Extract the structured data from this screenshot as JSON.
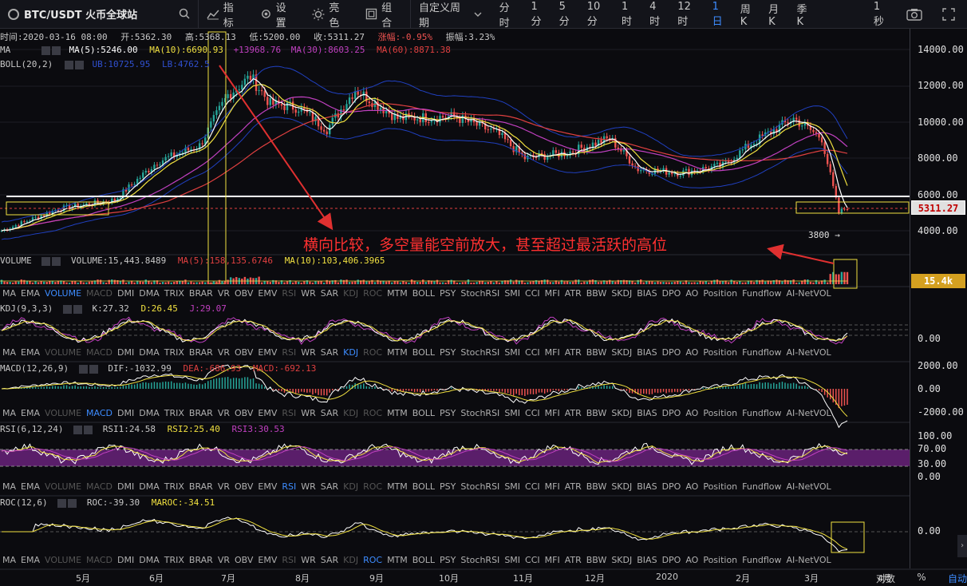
{
  "toolbar": {
    "symbol": "BTC/USDT 火币全球站",
    "indicator_label": "指标",
    "settings_label": "设置",
    "brightness_label": "亮色",
    "combo_label": "组合",
    "custom_period_label": "自定义周期",
    "periods": [
      "分时",
      "1分",
      "5分",
      "10分",
      "1时",
      "4时",
      "12时",
      "1日",
      "周K",
      "月K",
      "季K"
    ],
    "active_period": "1日",
    "refresh_label": "1秒"
  },
  "info_bar": {
    "time": "时间:2020-03-16 08:00",
    "open": "开:5362.30",
    "high": "高:5368.13",
    "low": "低:5200.00",
    "close": "收:5311.27",
    "change": "涨幅:-0.95%",
    "amplitude": "振幅:3.23%"
  },
  "ma_row": {
    "name": "MA",
    "ma5": "MA(5):5246.00",
    "ma10": "MA(10):6690.93",
    "ma30": "MA(30):8603.25",
    "ma60": "MA(60):8871.38",
    "overlay": "+13968.76"
  },
  "boll_row": {
    "name": "BOLL(20,2)",
    "ub": "UB:10725.95",
    "lb": "LB:4762.5"
  },
  "price_axis": [
    "14000.00",
    "12000.00",
    "10000.00",
    "8000.00",
    "6000.00",
    "4000.00"
  ],
  "last_price": "5311.27",
  "low_marker": "3800",
  "annotation": "横向比较，多空量能空前放大，甚至超过最活跃的高位",
  "volume_row": {
    "name": "VOLUME",
    "volume": "VOLUME:15,443.8489",
    "ma5": "MA(5):158,135.6746",
    "ma10": "MA(10):103,406.3965",
    "tag": "15.4k"
  },
  "tabs": [
    "MA",
    "EMA",
    "VOLUME",
    "MACD",
    "DMI",
    "DMA",
    "TRIX",
    "BRAR",
    "VR",
    "OBV",
    "EMV",
    "RSI",
    "WR",
    "SAR",
    "KDJ",
    "ROC",
    "MTM",
    "BOLL",
    "PSY",
    "StochRSI",
    "SMI",
    "CCI",
    "MFI",
    "ATR",
    "BBW",
    "SKDJ",
    "BIAS",
    "DPO",
    "AO",
    "Position",
    "Fundflow",
    "AI-NetVOL"
  ],
  "kdj_row": {
    "name": "KDJ(9,3,3)",
    "k": "K:27.32",
    "d": "D:26.45",
    "j": "J:29.07",
    "axis": "0.00"
  },
  "macd_row": {
    "name": "MACD(12,26,9)",
    "dif": "DIF:-1032.99",
    "dea": "DEA:-686.93",
    "macd": "MACD:-692.13",
    "axis": [
      "2000.00",
      "0.00",
      "-2000.00"
    ]
  },
  "rsi_row": {
    "name": "RSI(6,12,24)",
    "rsi1": "RSI1:24.58",
    "rsi2": "RSI2:25.40",
    "rsi3": "RSI3:30.53",
    "axis": [
      "100.00",
      "70.00",
      "30.00",
      "0.00"
    ]
  },
  "roc_row": {
    "name": "ROC(12,6)",
    "roc": "ROC:-39.30",
    "maroc": "MAROC:-34.51",
    "axis": "0.00"
  },
  "x_axis": [
    "5月",
    "6月",
    "7月",
    "8月",
    "9月",
    "10月",
    "11月",
    "12月",
    "2020",
    "2月",
    "3月",
    "4月"
  ],
  "footer": {
    "log_label": "对数",
    "pct_label": "%",
    "auto_label": "自动"
  },
  "colors": {
    "accent": "#3d8cff",
    "up": "#26a69a",
    "down": "#ef5350",
    "ma5": "#ffffff",
    "ma10": "#f0e040",
    "ma30": "#c040c0",
    "ma60": "#e04040",
    "boll": "#2040c0"
  }
}
